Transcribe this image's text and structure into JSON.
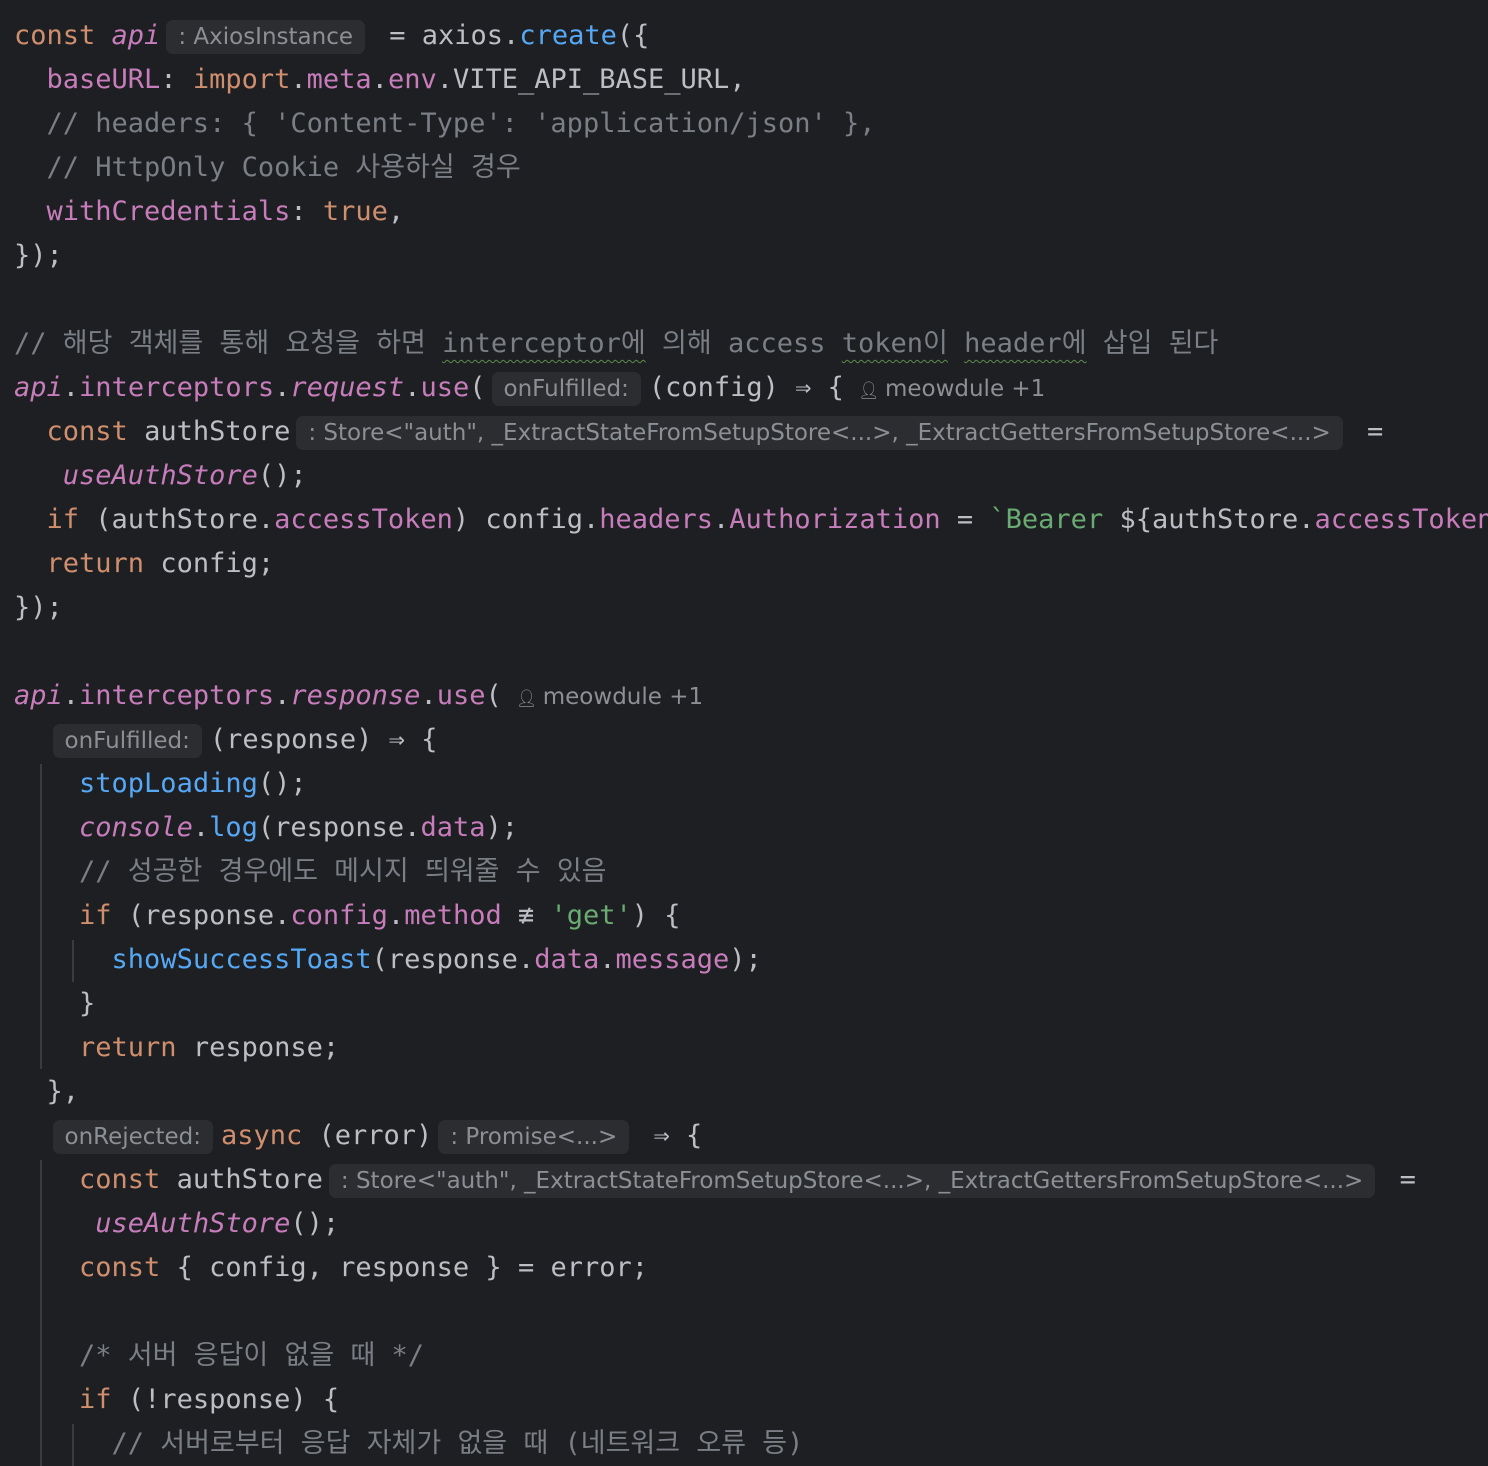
{
  "editor": {
    "lines": [
      [
        {
          "t": "const ",
          "c": "kw"
        },
        {
          "t": "api",
          "c": "gv"
        },
        {
          "h": ": AxiosInstance"
        },
        {
          "t": " = axios.",
          "c": "plain"
        },
        {
          "t": "create",
          "c": "fn"
        },
        {
          "t": "({",
          "c": "plain"
        }
      ],
      [
        {
          "t": "  "
        },
        {
          "t": "baseURL",
          "c": "prop"
        },
        {
          "t": ": ",
          "c": "plain"
        },
        {
          "t": "import",
          "c": "kw"
        },
        {
          "t": ".",
          "c": "plain"
        },
        {
          "t": "meta",
          "c": "prop"
        },
        {
          "t": ".",
          "c": "plain"
        },
        {
          "t": "env",
          "c": "prop"
        },
        {
          "t": ".VITE_API_BASE_URL,",
          "c": "plain"
        }
      ],
      [
        {
          "t": "  // headers: { 'Content-Type': 'application/json' },",
          "c": "cmt"
        }
      ],
      [
        {
          "t": "  // HttpOnly Cookie 사용하실 경우",
          "c": "cmt"
        }
      ],
      [
        {
          "t": "  "
        },
        {
          "t": "withCredentials",
          "c": "prop"
        },
        {
          "t": ": ",
          "c": "plain"
        },
        {
          "t": "true",
          "c": "kw"
        },
        {
          "t": ",",
          "c": "plain"
        }
      ],
      [
        {
          "t": "});",
          "c": "plain"
        }
      ],
      [],
      [
        {
          "t": "// 해당 객체를 통해 요청을 하면 ",
          "c": "cmt"
        },
        {
          "t": "interceptor에",
          "c": "cmt sq"
        },
        {
          "t": " 의해 access ",
          "c": "cmt"
        },
        {
          "t": "token이",
          "c": "cmt sq"
        },
        {
          "t": " ",
          "c": "cmt"
        },
        {
          "t": "header에",
          "c": "cmt sq"
        },
        {
          "t": " 삽입 된다",
          "c": "cmt"
        }
      ],
      [
        {
          "t": "api",
          "c": "gv"
        },
        {
          "t": ".",
          "c": "plain"
        },
        {
          "t": "interceptors",
          "c": "prop"
        },
        {
          "t": ".",
          "c": "plain"
        },
        {
          "t": "request",
          "c": "ifn"
        },
        {
          "t": ".",
          "c": "plain"
        },
        {
          "t": "use",
          "c": "prop"
        },
        {
          "t": "(",
          "c": "plain"
        },
        {
          "h": "onFulfilled:"
        },
        {
          "t": "(config) ⇒ {",
          "c": "plain"
        },
        {
          "a": "meowdule +1"
        }
      ],
      [
        {
          "t": "  "
        },
        {
          "t": "const ",
          "c": "kw"
        },
        {
          "t": "authStore",
          "c": "plain"
        },
        {
          "h": ": Store<\"auth\", _ExtractStateFromSetupStore<...>, _ExtractGettersFromSetupStore<...>"
        },
        {
          "t": " =",
          "c": "plain"
        }
      ],
      [
        {
          "t": "   "
        },
        {
          "t": "useAuthStore",
          "c": "ifn"
        },
        {
          "t": "();",
          "c": "plain"
        }
      ],
      [
        {
          "t": "  "
        },
        {
          "t": "if ",
          "c": "kw"
        },
        {
          "t": "(authStore.",
          "c": "plain"
        },
        {
          "t": "accessToken",
          "c": "prop"
        },
        {
          "t": ") config.",
          "c": "plain"
        },
        {
          "t": "headers",
          "c": "prop"
        },
        {
          "t": ".",
          "c": "plain"
        },
        {
          "t": "Authorization",
          "c": "prop"
        },
        {
          "t": " = ",
          "c": "plain"
        },
        {
          "t": "`Bearer ",
          "c": "str"
        },
        {
          "t": "${authStore.",
          "c": "plain"
        },
        {
          "t": "accessToken",
          "c": "prop"
        },
        {
          "t": "}",
          "c": "plain"
        },
        {
          "t": "`",
          "c": "str"
        },
        {
          "t": ";",
          "c": "plain"
        }
      ],
      [
        {
          "t": "  "
        },
        {
          "t": "return ",
          "c": "kw"
        },
        {
          "t": "config;",
          "c": "plain"
        }
      ],
      [
        {
          "t": "});",
          "c": "plain"
        }
      ],
      [],
      [
        {
          "t": "api",
          "c": "gv"
        },
        {
          "t": ".",
          "c": "plain"
        },
        {
          "t": "interceptors",
          "c": "prop"
        },
        {
          "t": ".",
          "c": "plain"
        },
        {
          "t": "response",
          "c": "ifn"
        },
        {
          "t": ".",
          "c": "plain"
        },
        {
          "t": "use",
          "c": "prop"
        },
        {
          "t": "(",
          "c": "plain"
        },
        {
          "a": "meowdule +1"
        }
      ],
      [
        {
          "t": "  "
        },
        {
          "h": "onFulfilled:"
        },
        {
          "t": "(response) ⇒ {",
          "c": "plain"
        }
      ],
      [
        {
          "t": "    "
        },
        {
          "t": "stopLoading",
          "c": "fn"
        },
        {
          "t": "();",
          "c": "plain"
        }
      ],
      [
        {
          "t": "    "
        },
        {
          "t": "console",
          "c": "gv"
        },
        {
          "t": ".",
          "c": "plain"
        },
        {
          "t": "log",
          "c": "fn"
        },
        {
          "t": "(response.",
          "c": "plain"
        },
        {
          "t": "data",
          "c": "prop"
        },
        {
          "t": ");",
          "c": "plain"
        }
      ],
      [
        {
          "t": "    // 성공한 경우에도 메시지 띄워줄 수 있음",
          "c": "cmt"
        }
      ],
      [
        {
          "t": "    "
        },
        {
          "t": "if ",
          "c": "kw"
        },
        {
          "t": "(response.",
          "c": "plain"
        },
        {
          "t": "config",
          "c": "prop"
        },
        {
          "t": ".",
          "c": "plain"
        },
        {
          "t": "method",
          "c": "prop"
        },
        {
          "t": " ≢ ",
          "c": "plain"
        },
        {
          "t": "'get'",
          "c": "str"
        },
        {
          "t": ") {",
          "c": "plain"
        }
      ],
      [
        {
          "t": "      "
        },
        {
          "t": "showSuccessToast",
          "c": "fn"
        },
        {
          "t": "(response.",
          "c": "plain"
        },
        {
          "t": "data",
          "c": "prop"
        },
        {
          "t": ".",
          "c": "plain"
        },
        {
          "t": "message",
          "c": "prop"
        },
        {
          "t": ");",
          "c": "plain"
        }
      ],
      [
        {
          "t": "    }",
          "c": "plain"
        }
      ],
      [
        {
          "t": "    "
        },
        {
          "t": "return ",
          "c": "kw"
        },
        {
          "t": "response;",
          "c": "plain"
        }
      ],
      [
        {
          "t": "  },",
          "c": "plain"
        }
      ],
      [
        {
          "t": "  "
        },
        {
          "h": "onRejected:"
        },
        {
          "t": "async ",
          "c": "kw"
        },
        {
          "t": "(error)",
          "c": "plain"
        },
        {
          "h": ": Promise<...>"
        },
        {
          "t": " ⇒ {",
          "c": "plain"
        }
      ],
      [
        {
          "t": "    "
        },
        {
          "t": "const ",
          "c": "kw"
        },
        {
          "t": "authStore",
          "c": "plain"
        },
        {
          "h": ": Store<\"auth\", _ExtractStateFromSetupStore<...>, _ExtractGettersFromSetupStore<...>"
        },
        {
          "t": " =",
          "c": "plain"
        }
      ],
      [
        {
          "t": "     "
        },
        {
          "t": "useAuthStore",
          "c": "ifn"
        },
        {
          "t": "();",
          "c": "plain"
        }
      ],
      [
        {
          "t": "    "
        },
        {
          "t": "const ",
          "c": "kw"
        },
        {
          "t": "{ config, response } = error;",
          "c": "plain"
        }
      ],
      [],
      [
        {
          "t": "    /* 서버 응답이 없을 때 */",
          "c": "cmt"
        }
      ],
      [
        {
          "t": "    "
        },
        {
          "t": "if ",
          "c": "kw"
        },
        {
          "t": "(!response) {",
          "c": "plain"
        }
      ],
      [
        {
          "t": "      // 서버로부터 응답 자체가 없을 때 (네트워크 오류 등)",
          "c": "cmt"
        }
      ]
    ]
  }
}
